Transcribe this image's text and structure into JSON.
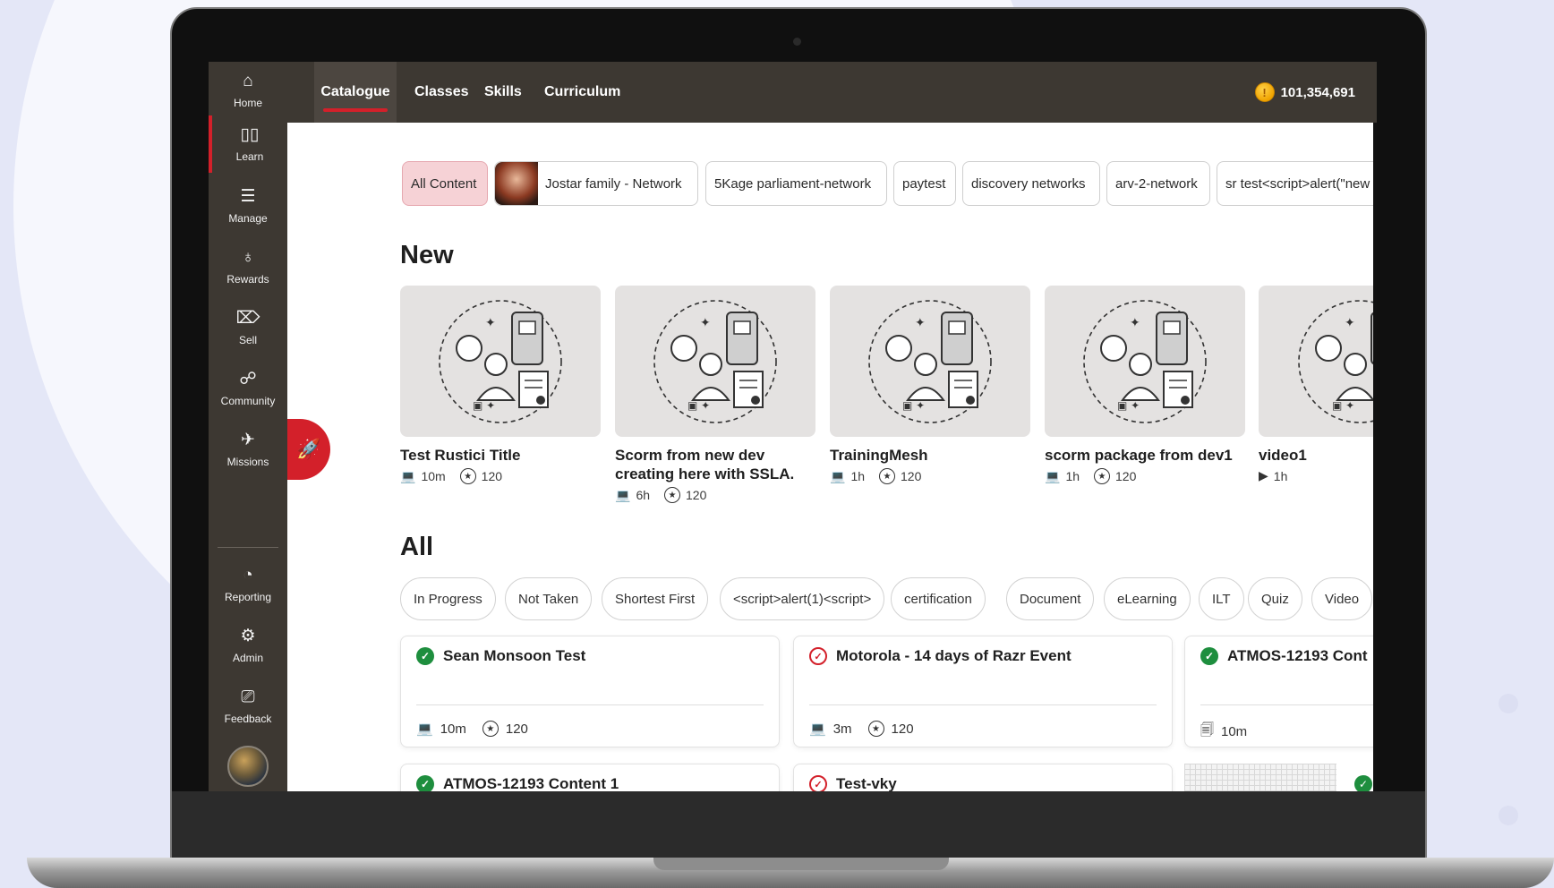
{
  "sidebar": {
    "items": [
      {
        "label": "Home",
        "icon": "home-icon",
        "glyph": "⌂"
      },
      {
        "label": "Learn",
        "icon": "book-icon",
        "glyph": "▯▯"
      },
      {
        "label": "Manage",
        "icon": "checklist-icon",
        "glyph": "☰"
      },
      {
        "label": "Rewards",
        "icon": "award-icon",
        "glyph": "♁"
      },
      {
        "label": "Sell",
        "icon": "tag-icon",
        "glyph": "⌦"
      },
      {
        "label": "Community",
        "icon": "chat-icon",
        "glyph": "☍"
      },
      {
        "label": "Missions",
        "icon": "rocket-icon",
        "glyph": "✈"
      }
    ],
    "bottom_items": [
      {
        "label": "Reporting",
        "icon": "pie-chart-icon",
        "glyph": "◔"
      },
      {
        "label": "Admin",
        "icon": "gear-icon",
        "glyph": "⚙"
      },
      {
        "label": "Feedback",
        "icon": "feedback-icon",
        "glyph": "⎚"
      }
    ]
  },
  "topbar": {
    "tabs": [
      "Catalogue",
      "Classes",
      "Skills",
      "Curriculum"
    ],
    "active_tab": "Catalogue",
    "coins": "101,354,691"
  },
  "networks": [
    "All Content",
    "Jostar family - Network",
    "5Kage parliament-network",
    "paytest",
    "discovery networks",
    "arv-2-network",
    "sr test<script>alert(\"new"
  ],
  "new_section": {
    "title": "New",
    "cards": [
      {
        "title": "Test Rustici Title",
        "meta_icon": "laptop-icon",
        "duration": "10m",
        "points": "120"
      },
      {
        "title": "Scorm from new dev creating here with SSLA.",
        "meta_icon": "laptop-icon",
        "duration": "6h",
        "points": "120"
      },
      {
        "title": "TrainingMesh",
        "meta_icon": "laptop-icon",
        "duration": "1h",
        "points": "120"
      },
      {
        "title": "scorm package from dev1",
        "meta_icon": "laptop-icon",
        "duration": "1h",
        "points": "120"
      },
      {
        "title": "video1",
        "meta_icon": "video-icon",
        "duration": "1h",
        "points": ""
      }
    ]
  },
  "all_section": {
    "title": "All",
    "filters": [
      "In Progress",
      "Not Taken",
      "Shortest First",
      "<script>alert(1)<script>",
      "certification",
      "Document",
      "eLearning",
      "ILT",
      "Quiz",
      "Video"
    ],
    "items": [
      {
        "title": "Sean Monsoon Test",
        "status": "completed",
        "meta_icon": "laptop-icon",
        "duration": "10m",
        "points": "120"
      },
      {
        "title": "Motorola - 14 days of Razr Event",
        "status": "pending",
        "meta_icon": "laptop-icon",
        "duration": "3m",
        "points": "120"
      },
      {
        "title": "ATMOS-12193 Cont",
        "status": "completed",
        "meta_icon": "document-icon",
        "duration": "10m",
        "points": ""
      },
      {
        "title": "ATMOS-12193 Content 1",
        "status": "completed"
      },
      {
        "title": "Test-vky",
        "status": "pending"
      }
    ]
  },
  "colors": {
    "sidebar_bg": "#3d3832",
    "accent_red": "#d3202a",
    "success_green": "#1e8e3e",
    "active_chip_bg": "#f6d2d6"
  }
}
